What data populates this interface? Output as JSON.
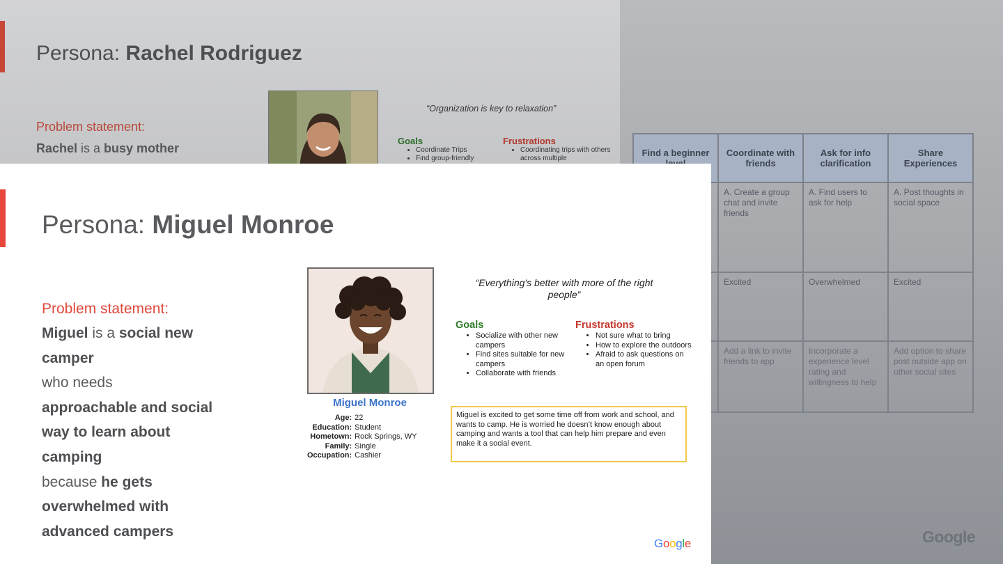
{
  "journey": {
    "headers": [
      "Find a beginner level",
      "Coordinate with friends",
      "Ask for info clarification",
      "Share Experiences"
    ],
    "actions": [
      "",
      "A. Create a group chat and invite friends",
      "A. Find users to ask for help",
      "A. Post thoughts in social space"
    ],
    "emotions": [
      "",
      "Excited",
      "Overwhelmed",
      "Excited"
    ],
    "opportunities": [
      "",
      "Add a link to invite friends to app",
      "Incorporate a experience level rating and willingness to help",
      "Add option to share post outside app on other social sites"
    ],
    "logo": "Google"
  },
  "rachel": {
    "title_prefix": "Persona: ",
    "title_name": "Rachel Rodriguez",
    "problem_label": "Problem statement:",
    "desc_name": "Rachel",
    "desc_mid": " is a ",
    "desc_bold": "busy mother",
    "quote": "“Organization is key to relaxation”",
    "goals_label": "Goals",
    "goals": [
      "Coordinate Trips",
      "Find group-friendly"
    ],
    "frustrations_label": "Frustrations",
    "frustrations": [
      "Coordinating trips with others across multiple"
    ]
  },
  "miguel": {
    "title_prefix": "Persona: ",
    "title_name": "Miguel Monroe",
    "problem_label": "Problem statement:",
    "problem_parts": {
      "p1": "Miguel",
      "p2": " is a ",
      "p3": "social new camper",
      "p4": "who needs",
      "p5": "approachable and social way to learn about camping",
      "p6": "because ",
      "p7": "he gets overwhelmed with advanced campers"
    },
    "name": "Miguel Monroe",
    "info": [
      {
        "k": "Age:",
        "v": "22"
      },
      {
        "k": "Education:",
        "v": "Student"
      },
      {
        "k": "Hometown:",
        "v": "Rock Springs, WY"
      },
      {
        "k": "Family:",
        "v": "Single"
      },
      {
        "k": "Occupation:",
        "v": "Cashier"
      }
    ],
    "quote": "“Everything's better with more of the right people”",
    "goals_label": "Goals",
    "goals": [
      "Socialize with other new campers",
      "Find sites suitable for new campers",
      "Collaborate with friends"
    ],
    "frustrations_label": "Frustrations",
    "frustrations": [
      "Not sure what to bring",
      "How to explore the outdoors",
      "Afraid to ask questions on an open forum"
    ],
    "bio": "Miguel is excited to get some time off from work and school, and wants to camp. He is worried he doesn’t know enough about camping and wants a tool that can help him prepare and even make it a social event.",
    "logo": "Google"
  },
  "colors": {
    "accent_red": "#e8453c",
    "goals_green": "#2d7a26",
    "name_blue": "#3b73c8",
    "bio_border": "#f2c94c"
  }
}
